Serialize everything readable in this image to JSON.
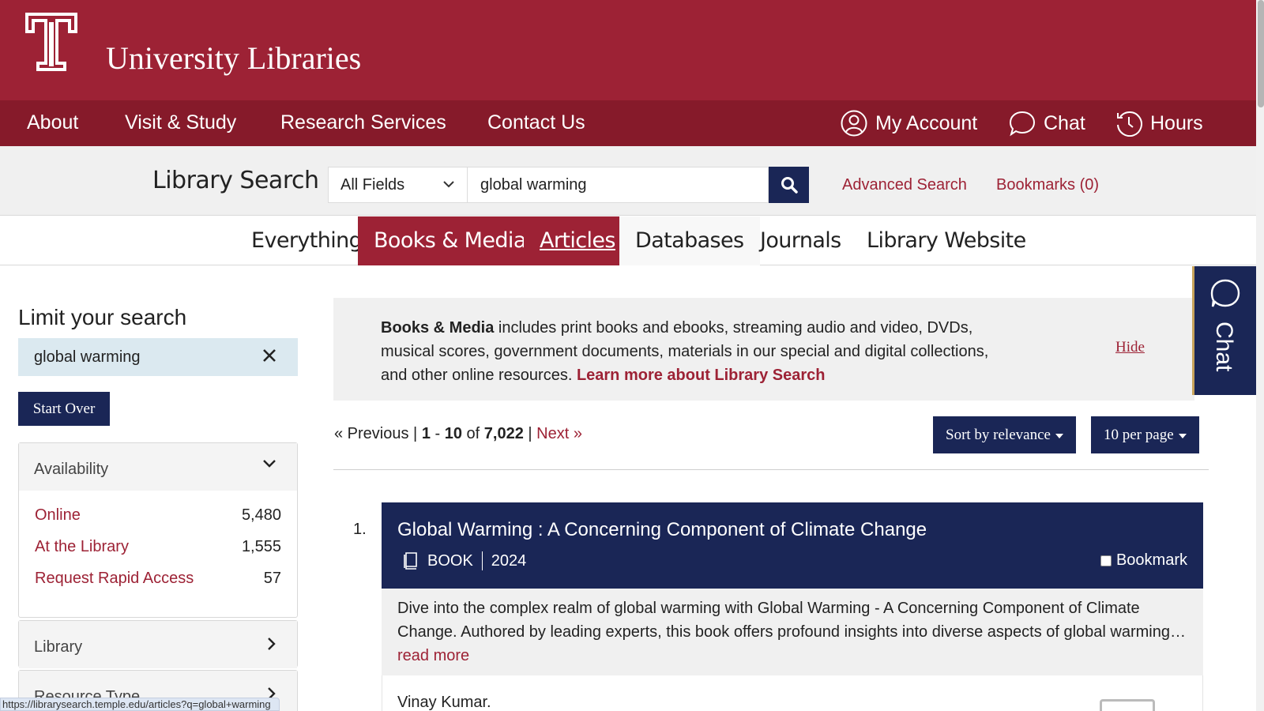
{
  "header": {
    "title": "University Libraries",
    "logo_icon": "temple-t-logo"
  },
  "nav": {
    "items": [
      "About",
      "Visit & Study",
      "Research Services",
      "Contact Us"
    ],
    "account_label": "My Account",
    "chat_label": "Chat",
    "hours_label": "Hours"
  },
  "search": {
    "heading": "Library Search",
    "field": "All Fields",
    "query": "global warming",
    "advanced_label": "Advanced Search",
    "bookmarks_label": "Bookmarks (0)"
  },
  "tabs": [
    "Everything",
    "Books & Media",
    "Articles",
    "Databases",
    "Journals",
    "Library Website"
  ],
  "sidebar": {
    "title": "Limit your search",
    "constraint": "global warming",
    "start_over": "Start Over",
    "availability": {
      "label": "Availability",
      "rows": [
        {
          "label": "Online",
          "count": "5,480"
        },
        {
          "label": "At the Library",
          "count": "1,555"
        },
        {
          "label": "Request Rapid Access",
          "count": "57"
        }
      ]
    },
    "library_label": "Library",
    "resource_type_label": "Resource Type"
  },
  "info": {
    "bold": "Books & Media",
    "text": " includes print books and ebooks, streaming audio and video, DVDs, musical scores, government documents, materials in our special and digital collections, and other online resources. ",
    "link": "Learn more about Library Search",
    "hide": "Hide"
  },
  "chat_widget": {
    "label": "Chat"
  },
  "pager": {
    "prev": "« Previous",
    "sep1": " | ",
    "start": "1",
    "dash": " - ",
    "end": "10",
    "of": " of ",
    "total": "7,022",
    "sep2": " | ",
    "next": "Next »",
    "sort_label": "Sort by relevance",
    "per_page_label": "10 per page"
  },
  "results": [
    {
      "number": "1.",
      "title": "Global Warming : A Concerning Component of Climate Change",
      "format": "BOOK",
      "year": "2024",
      "bookmark_label": "Bookmark",
      "snippet": "Dive into the complex realm of global warming with Global Warming - A Concerning Component of Climate Change. Authored by leading experts, this book offers profound insights into diverse aspects of global warming…",
      "read_more": "read more",
      "author": "Vinay Kumar."
    }
  ],
  "status_url": "https://librarysearch.temple.edu/articles?q=global+warming",
  "colors": {
    "cherry": "#9d2235",
    "cherry_dark": "#861a2a",
    "navy": "#1a2656"
  }
}
